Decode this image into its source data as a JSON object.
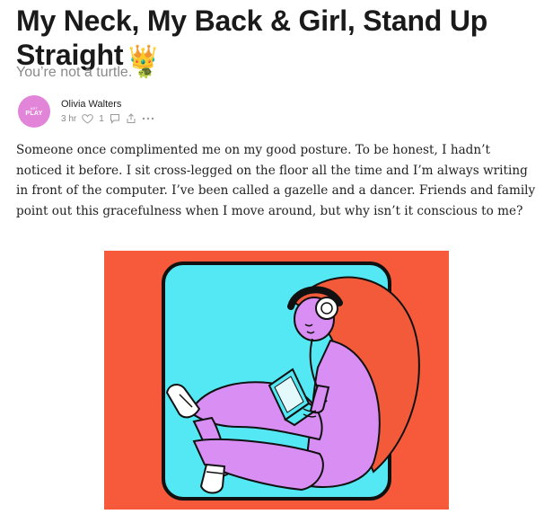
{
  "article": {
    "title": "My Neck, My Back & Girl, Stand Up Straight",
    "title_emoji": "👑",
    "subtitle": "You’re not a turtle.",
    "subtitle_emoji": "🐢",
    "author": {
      "name": "Olivia Walters",
      "avatar_top_text": "ART",
      "avatar_main_text": "PLAY"
    },
    "meta": {
      "time": "3 hr",
      "like_count": "1"
    },
    "paragraph": "Someone once complimented me on my good posture. To be honest, I hadn’t noticed it before. I sit cross-legged on the floor all the time and I’m always writing in front of the computer. I’ve been called a gazelle and a dancer. Friends and family point out this gracefulness when I move around, but why isn’t it conscious to me?"
  },
  "colors": {
    "illustration_bg": "#f65a3b",
    "illustration_panel": "#54e8f4",
    "figure_purple": "#d88ef2",
    "hair": "#f25a3a",
    "avatar": "#e284d8"
  },
  "icons": [
    "heart-icon",
    "comment-icon",
    "share-icon",
    "more-icon"
  ]
}
